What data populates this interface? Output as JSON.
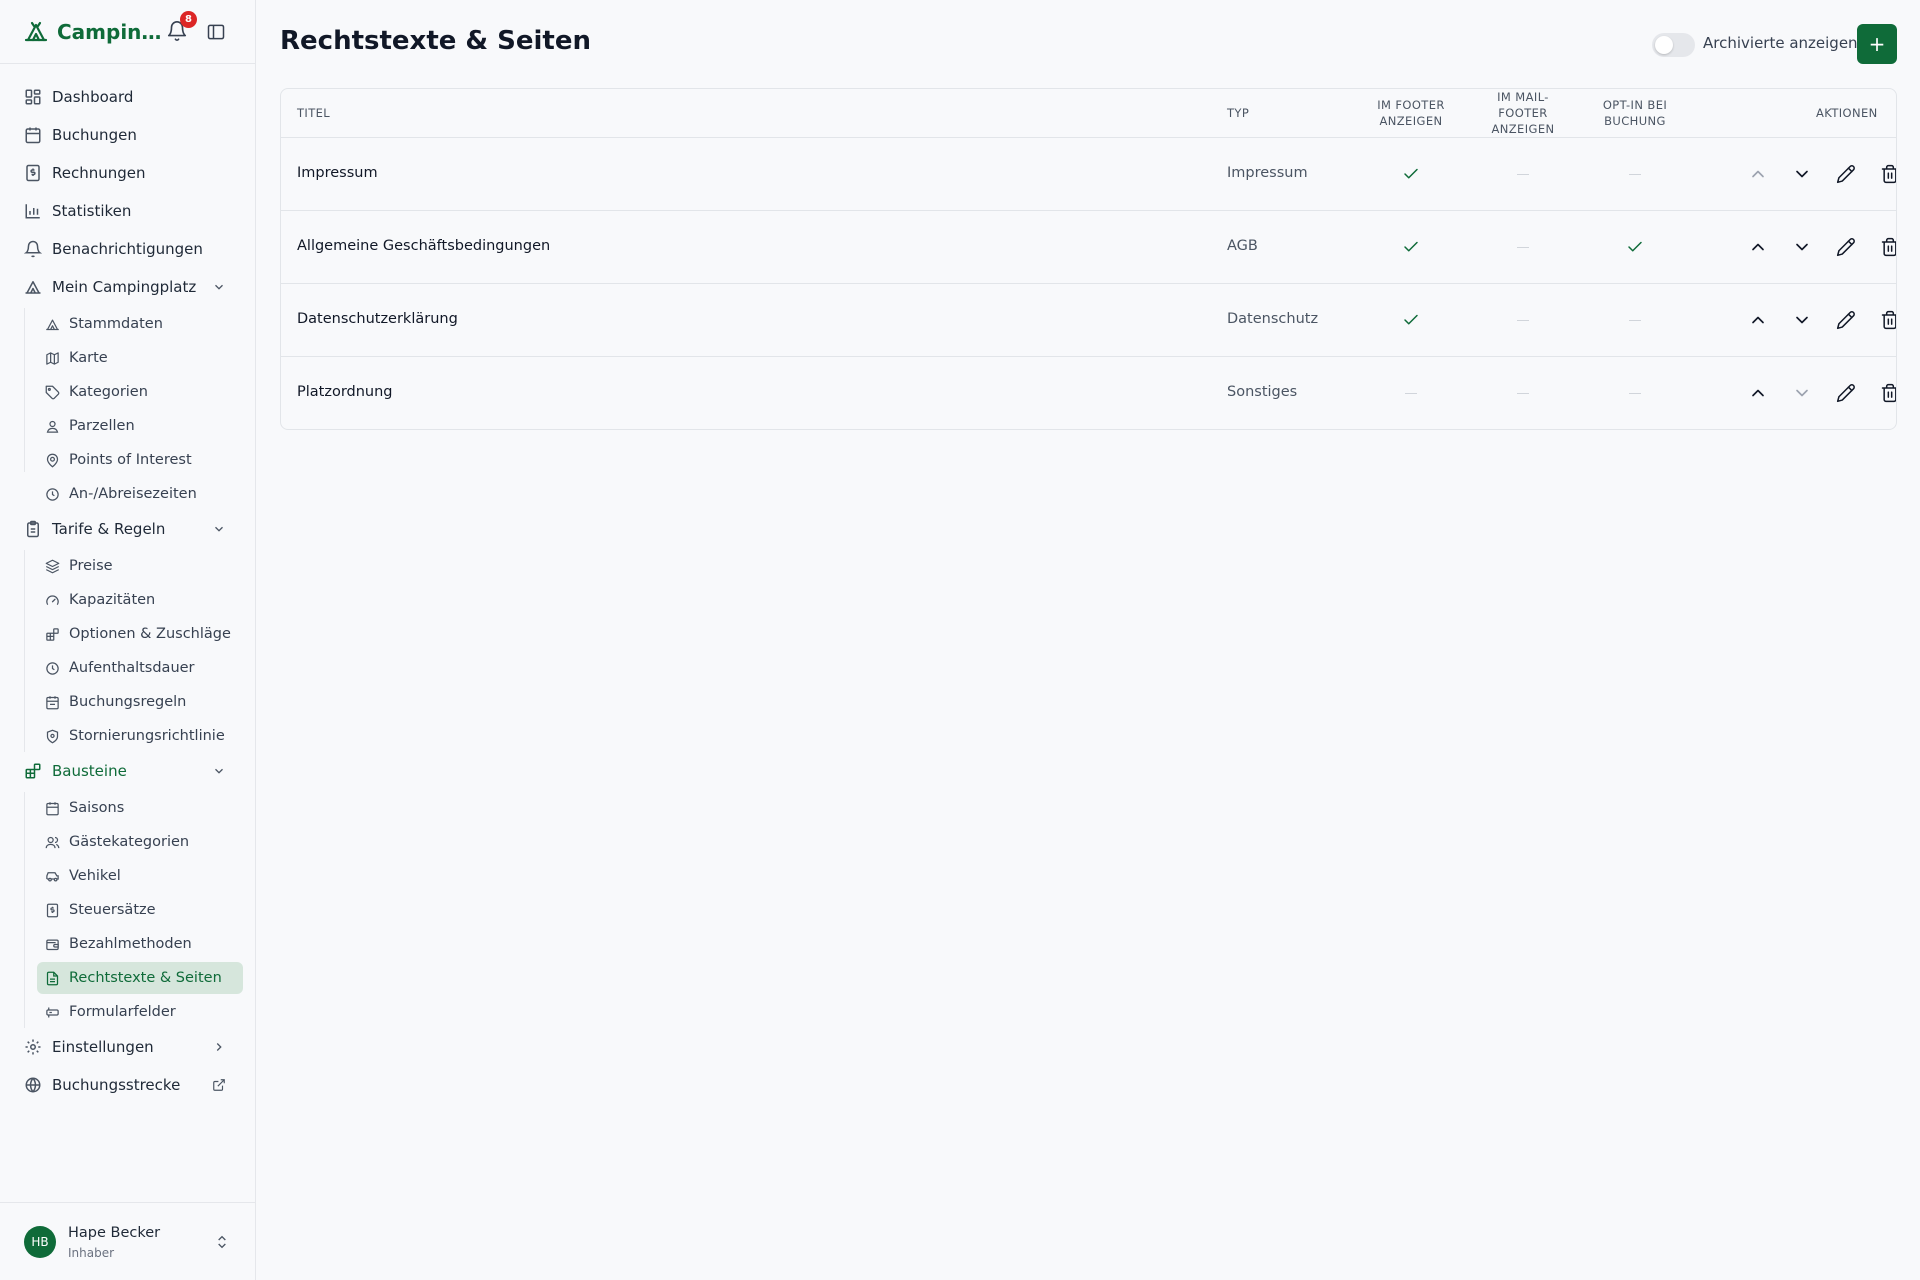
{
  "app": {
    "brand_name": "Campin…",
    "notification_count": "8"
  },
  "sidebar": {
    "items": [
      {
        "label": "Dashboard",
        "icon": "dashboard-icon"
      },
      {
        "label": "Buchungen",
        "icon": "calendar-icon"
      },
      {
        "label": "Rechnungen",
        "icon": "invoice-icon"
      },
      {
        "label": "Statistiken",
        "icon": "bar-chart-icon"
      },
      {
        "label": "Benachrichtigungen",
        "icon": "bell-icon"
      }
    ],
    "groups": [
      {
        "label": "Mein Campingplatz",
        "icon": "tent-icon",
        "expanded": true,
        "children": [
          {
            "label": "Stammdaten",
            "icon": "tent-icon"
          },
          {
            "label": "Karte",
            "icon": "map-icon"
          },
          {
            "label": "Kategorien",
            "icon": "tag-icon"
          },
          {
            "label": "Parzellen",
            "icon": "plot-icon"
          },
          {
            "label": "Points of Interest",
            "icon": "map-pin-icon"
          },
          {
            "label": "An-/Abreisezeiten",
            "icon": "clock-icon"
          }
        ]
      },
      {
        "label": "Tarife & Regeln",
        "icon": "clipboard-icon",
        "expanded": true,
        "children": [
          {
            "label": "Preise",
            "icon": "layers-icon"
          },
          {
            "label": "Kapazitäten",
            "icon": "gauge-icon"
          },
          {
            "label": "Optionen & Zuschläge",
            "icon": "blocks-icon"
          },
          {
            "label": "Aufenthaltsdauer",
            "icon": "clock-icon"
          },
          {
            "label": "Buchungsregeln",
            "icon": "calendar-icon"
          },
          {
            "label": "Stornierungsrichtlinie",
            "icon": "shield-icon"
          }
        ]
      },
      {
        "label": "Bausteine",
        "icon": "blocks-icon",
        "expanded": true,
        "active": true,
        "children": [
          {
            "label": "Saisons",
            "icon": "calendar-icon"
          },
          {
            "label": "Gästekategorien",
            "icon": "users-icon"
          },
          {
            "label": "Vehikel",
            "icon": "car-icon"
          },
          {
            "label": "Steuersätze",
            "icon": "receipt-icon"
          },
          {
            "label": "Bezahlmethoden",
            "icon": "wallet-icon"
          },
          {
            "label": "Rechtstexte & Seiten",
            "icon": "document-icon",
            "selected": true
          },
          {
            "label": "Formularfelder",
            "icon": "form-icon"
          }
        ]
      }
    ],
    "settings": {
      "label": "Einstellungen",
      "icon": "gear-icon"
    },
    "booking_flow": {
      "label": "Buchungsstrecke",
      "icon": "globe-icon"
    },
    "user": {
      "initials": "HB",
      "name": "Hape Becker",
      "role": "Inhaber"
    }
  },
  "main": {
    "title": "Rechtstexte & Seiten",
    "archived_toggle_label": "Archivierte anzeigen",
    "archived_toggle_on": false,
    "add_button_label": "+",
    "table": {
      "headers": {
        "title": "Titel",
        "type": "Typ",
        "footer": [
          "Im Footer",
          "anzeigen"
        ],
        "mail_footer": [
          "Im Mail-",
          "Footer",
          "anzeigen"
        ],
        "optin": [
          "Opt-in bei",
          "Buchung"
        ],
        "actions": "Aktionen"
      },
      "rows": [
        {
          "title": "Impressum",
          "type": "Impressum",
          "footer": true,
          "mail_footer": false,
          "optin": false,
          "can_move_up": false,
          "can_move_down": true
        },
        {
          "title": "Allgemeine Geschäftsbedingungen",
          "type": "AGB",
          "footer": true,
          "mail_footer": false,
          "optin": true,
          "can_move_up": true,
          "can_move_down": true
        },
        {
          "title": "Datenschutzerklärung",
          "type": "Datenschutz",
          "footer": true,
          "mail_footer": false,
          "optin": false,
          "can_move_up": true,
          "can_move_down": true
        },
        {
          "title": "Platzordnung",
          "type": "Sonstiges",
          "footer": false,
          "mail_footer": false,
          "optin": false,
          "can_move_up": true,
          "can_move_down": false
        }
      ]
    }
  },
  "colors": {
    "accent": "#0f6b39",
    "badge": "#dc2626",
    "selected_bg": "#d6e6dc"
  }
}
